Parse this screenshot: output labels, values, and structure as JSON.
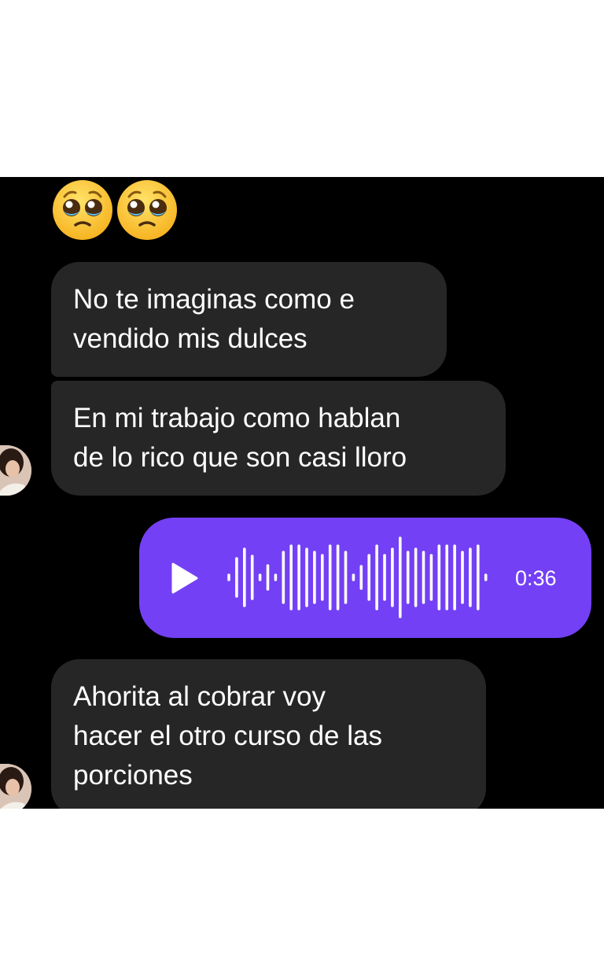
{
  "messages": {
    "reaction_emojis": [
      "pleading-face-icon",
      "pleading-face-icon"
    ],
    "bubble_1": {
      "line1": "No te imaginas como e",
      "line2": "vendido mis dulces"
    },
    "bubble_2": {
      "line1": "En mi trabajo como hablan",
      "line2": "de lo rico que son casi lloro"
    },
    "audio": {
      "duration": "0:36",
      "icon": "play-icon"
    },
    "bubble_3": {
      "line1": "Ahorita al cobrar voy",
      "line2": "hacer el otro curso de las",
      "line3": "porciones"
    }
  },
  "colors": {
    "background": "#000000",
    "incoming_bubble": "#262626",
    "outgoing_bubble": "#7340f5",
    "text": "#ffffff"
  }
}
